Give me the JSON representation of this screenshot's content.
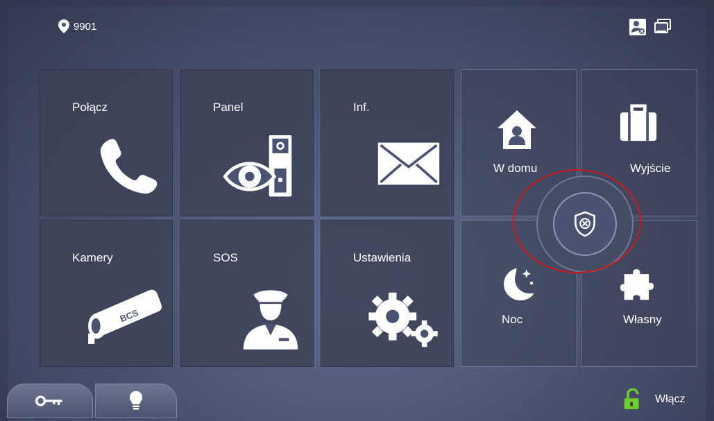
{
  "header": {
    "location": "9901"
  },
  "tiles": [
    {
      "label": "Połącz"
    },
    {
      "label": "Panel"
    },
    {
      "label": "Inf."
    },
    {
      "label": "Kamery"
    },
    {
      "label": "SOS"
    },
    {
      "label": "Ustawienia"
    }
  ],
  "camera_brand": "BCS",
  "modes": [
    {
      "label": "W domu"
    },
    {
      "label": "Wyjście"
    },
    {
      "label": "Noc"
    },
    {
      "label": "Własny"
    }
  ],
  "footer": {
    "unlock_label": "Włącz"
  },
  "colors": {
    "annotation": "#d01818",
    "unlock_icon": "#6fcf2a",
    "panel": "#3c4256"
  }
}
